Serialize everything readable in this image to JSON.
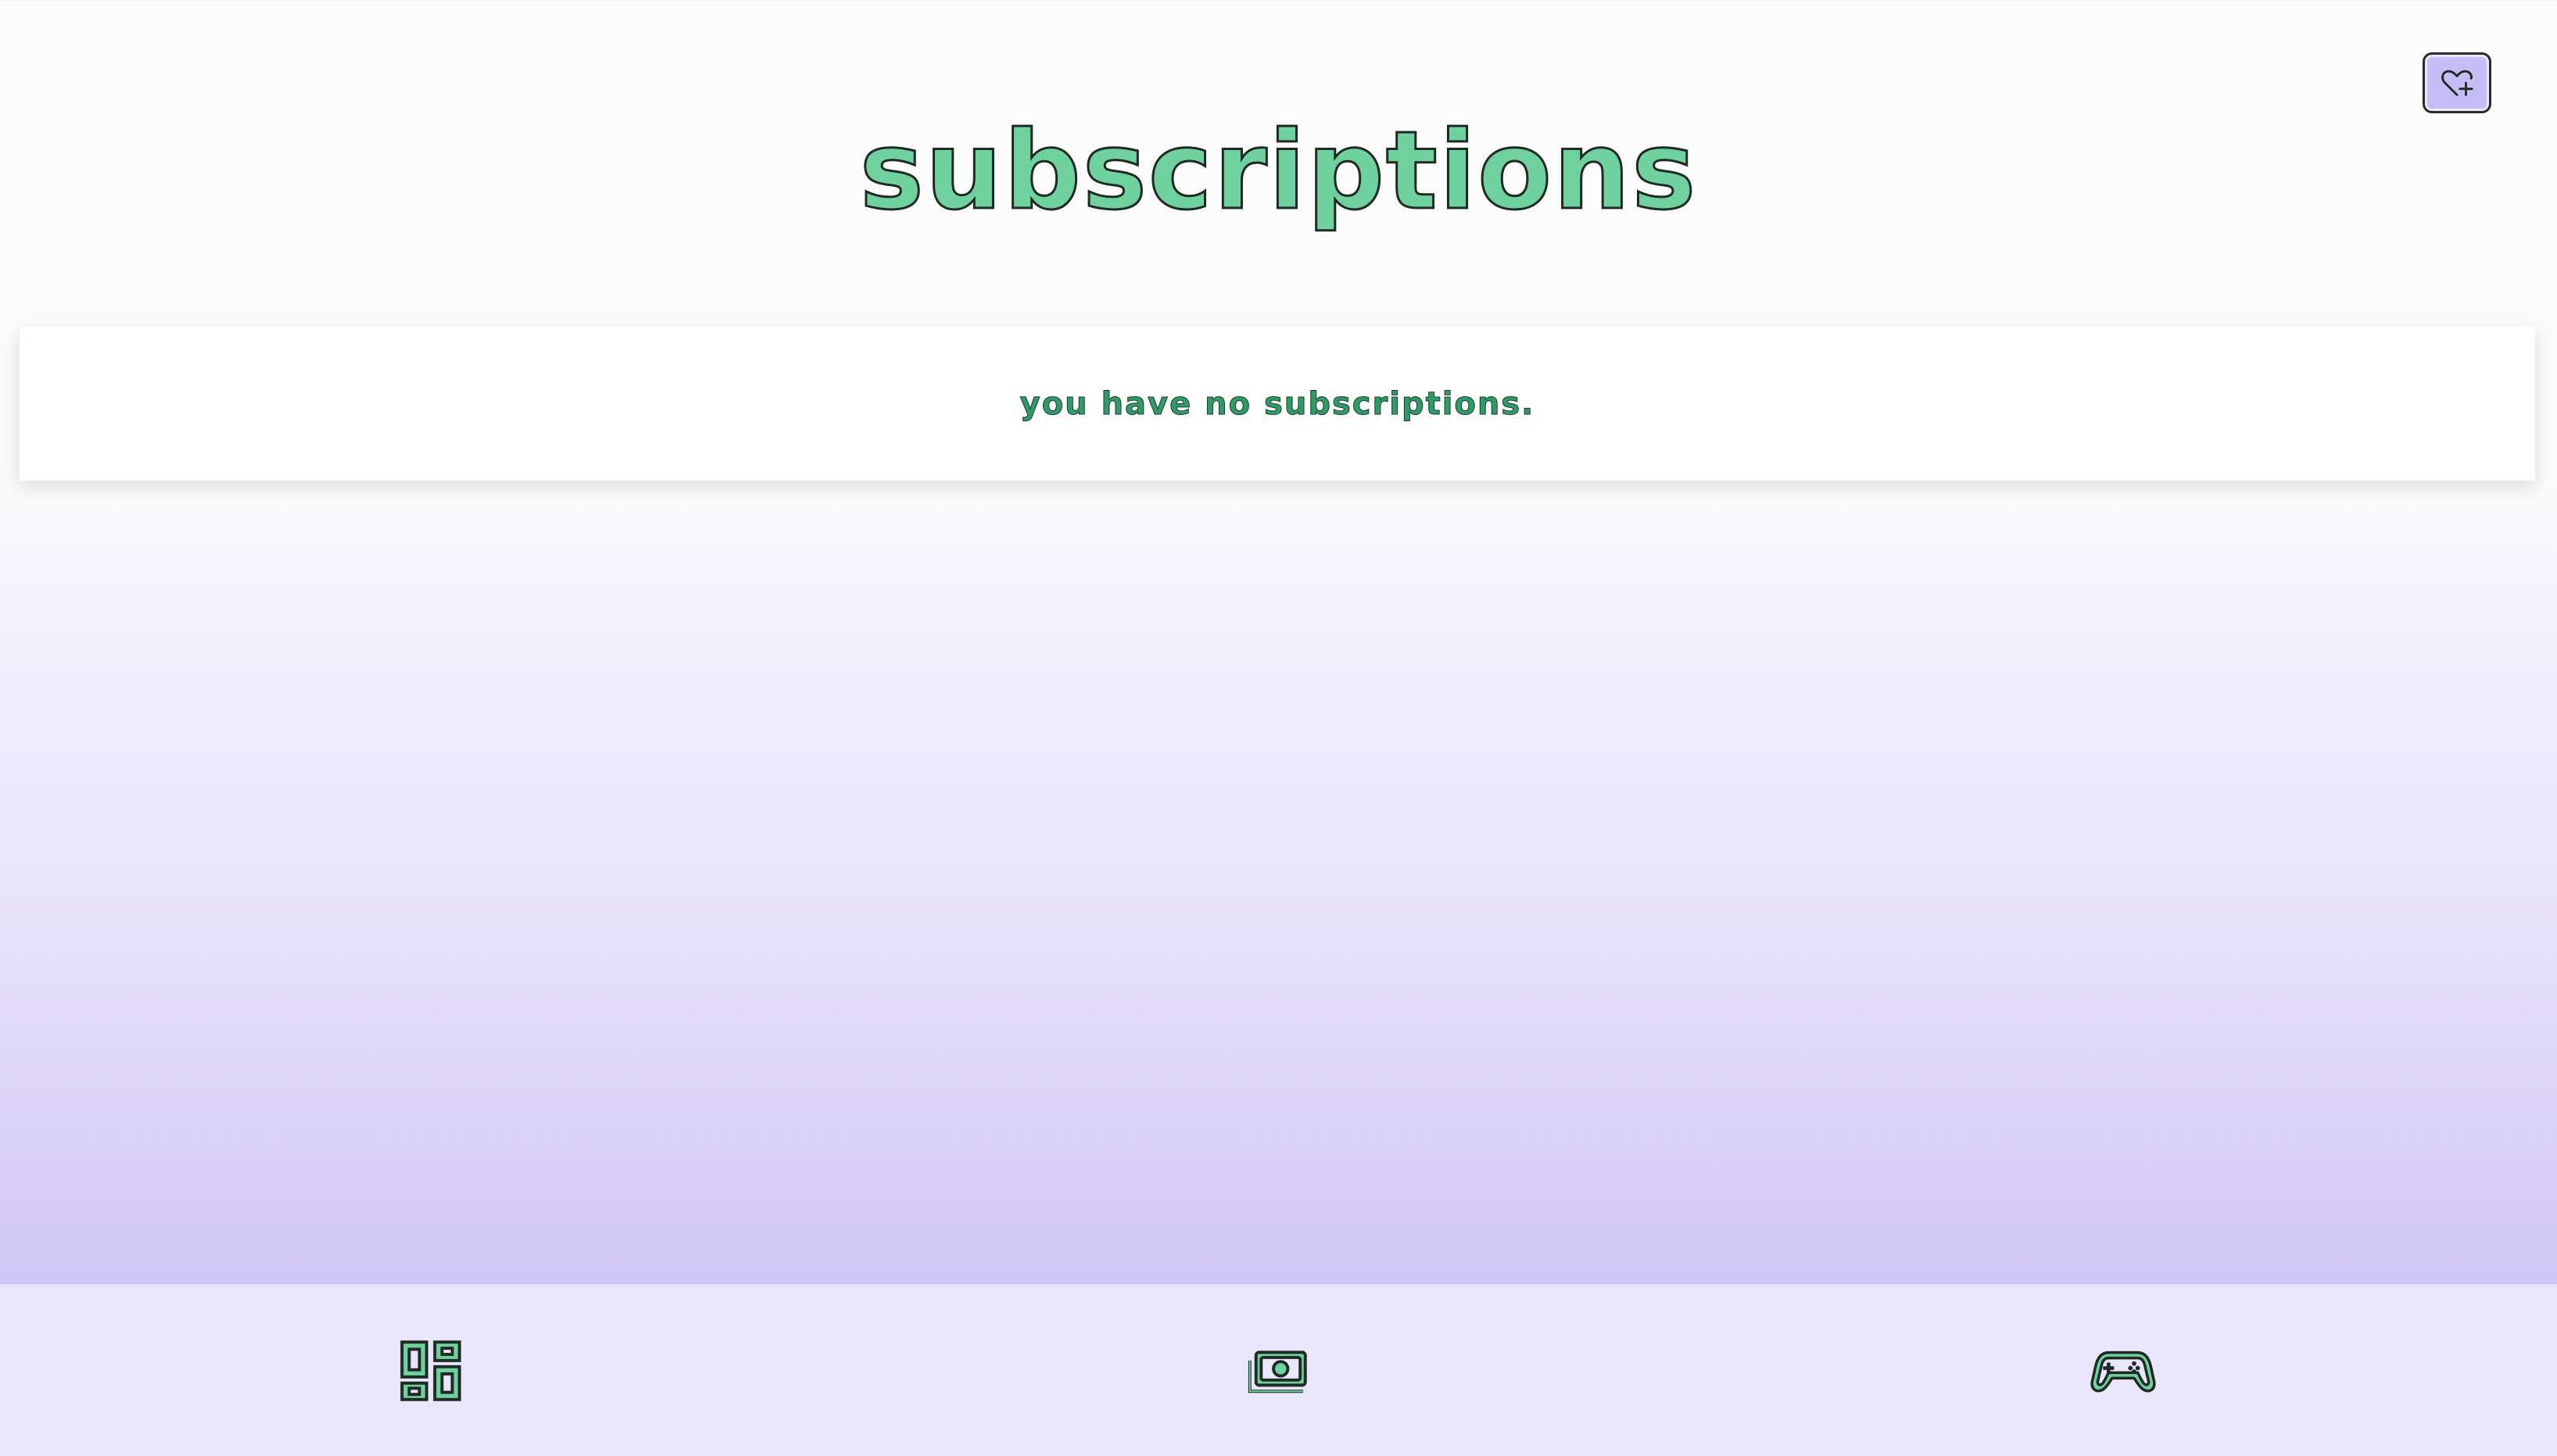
{
  "page": {
    "title": "subscriptions",
    "empty_message": "you have no subscriptions."
  },
  "header": {
    "add_button_icon": "heart-plus-icon"
  },
  "bottom_nav": {
    "items": [
      {
        "icon": "dashboard-icon"
      },
      {
        "icon": "money-icon"
      },
      {
        "icon": "gamepad-icon"
      }
    ]
  },
  "colors": {
    "accent_green": "#6fd19e",
    "text_green": "#2f9b67",
    "button_purple": "#c7bdf6",
    "nav_background": "#e9e5fb"
  }
}
